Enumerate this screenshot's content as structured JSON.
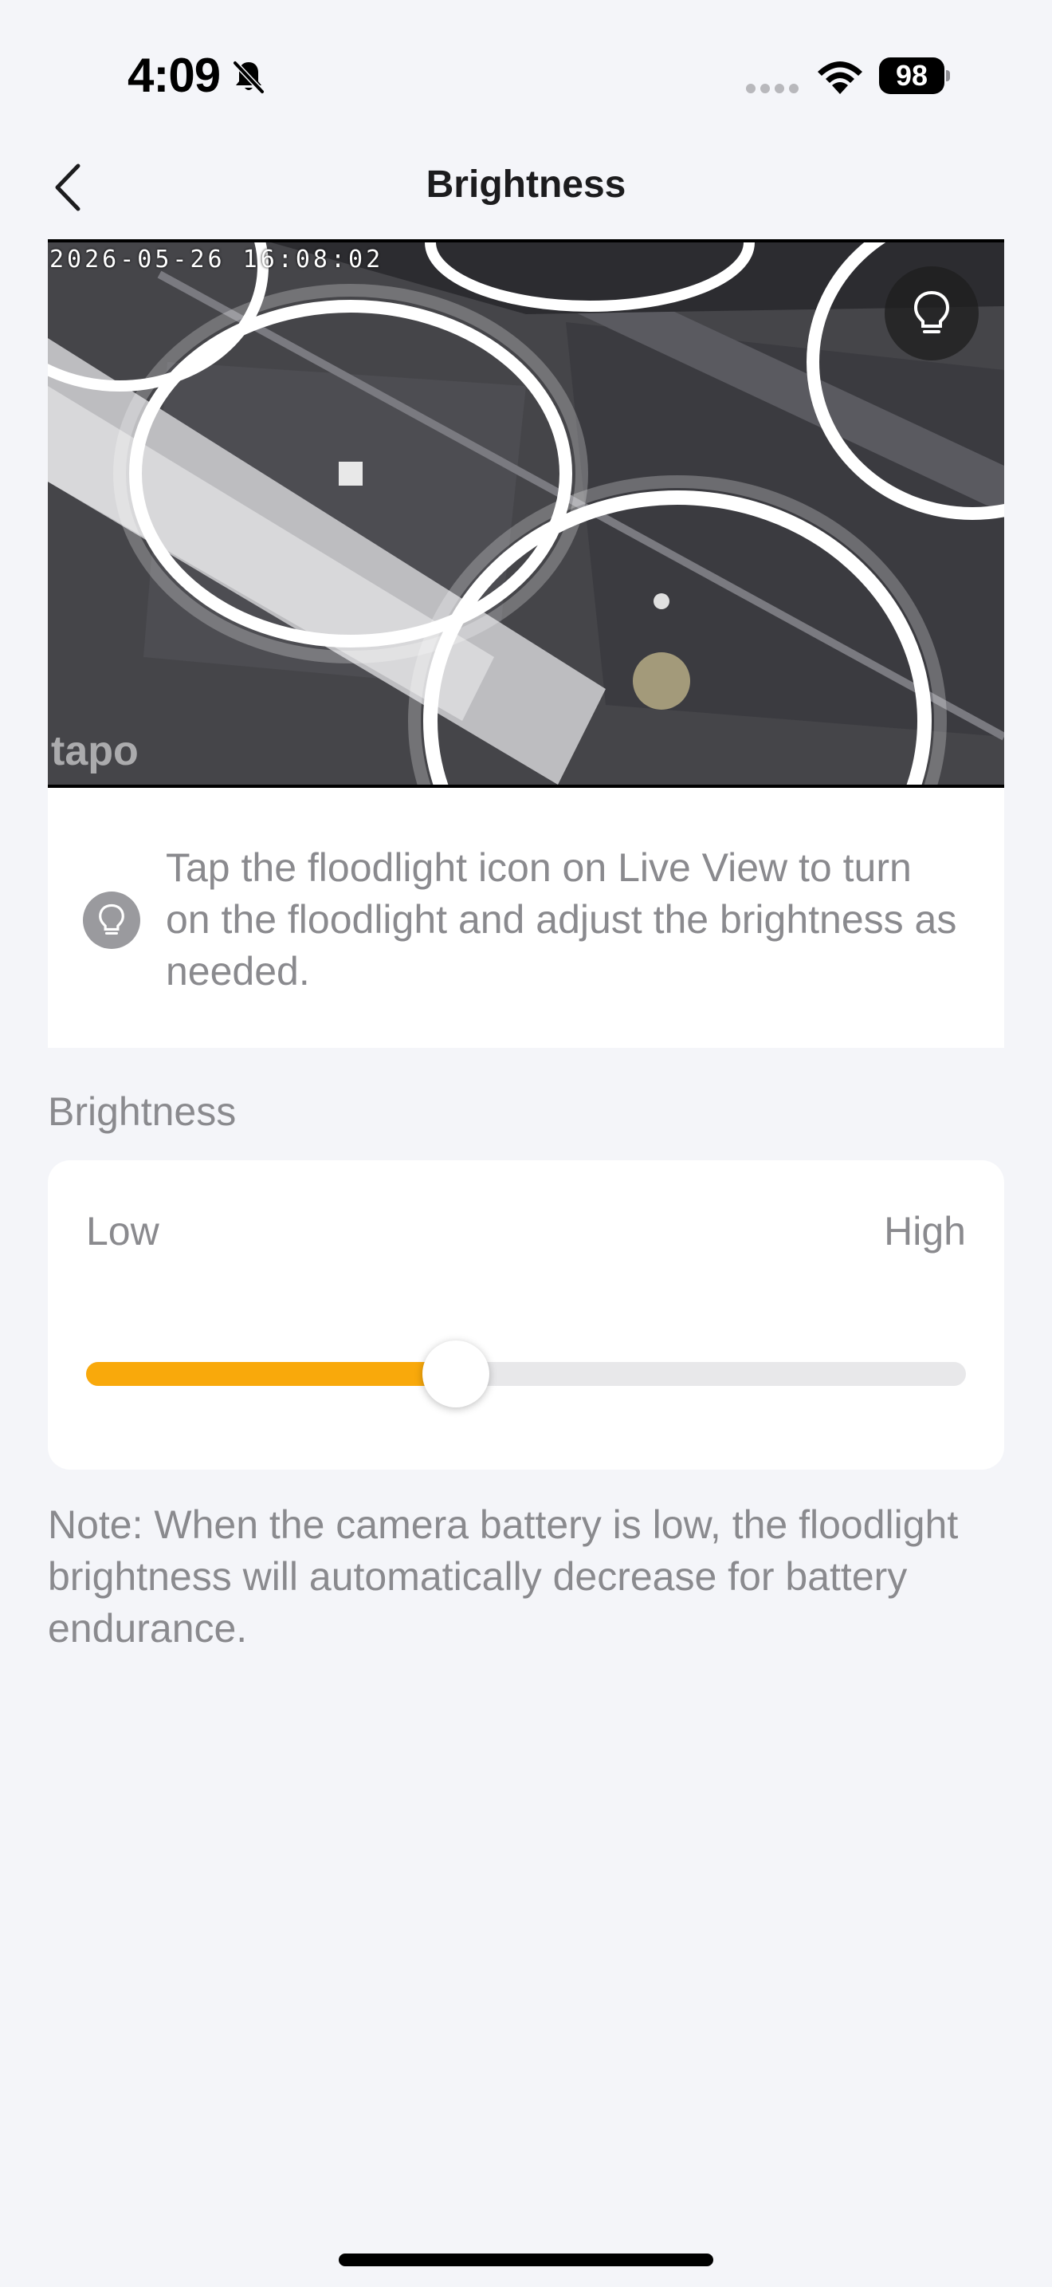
{
  "status_bar": {
    "time": "4:09",
    "battery_level": "98",
    "icons": [
      "bell-off-icon",
      "signal-dots-icon",
      "wifi-icon",
      "battery-icon"
    ]
  },
  "nav": {
    "title": "Brightness",
    "back_icon": "chevron-left-icon"
  },
  "camera": {
    "timestamp": "2026-05-26 16:08:02",
    "watermark": "tapo",
    "floodlight_icon": "lightbulb-icon"
  },
  "tip": {
    "icon": "lightbulb-icon",
    "text": "Tap the floodlight icon on Live View to turn on the floodlight and adjust the brightness as needed."
  },
  "brightness": {
    "section_label": "Brightness",
    "low_label": "Low",
    "high_label": "High",
    "value_percent": 42,
    "accent_color": "#f9a90b"
  },
  "note": {
    "text": "Note: When the camera battery is low, the floodlight brightness will automatically decrease for battery endurance."
  }
}
